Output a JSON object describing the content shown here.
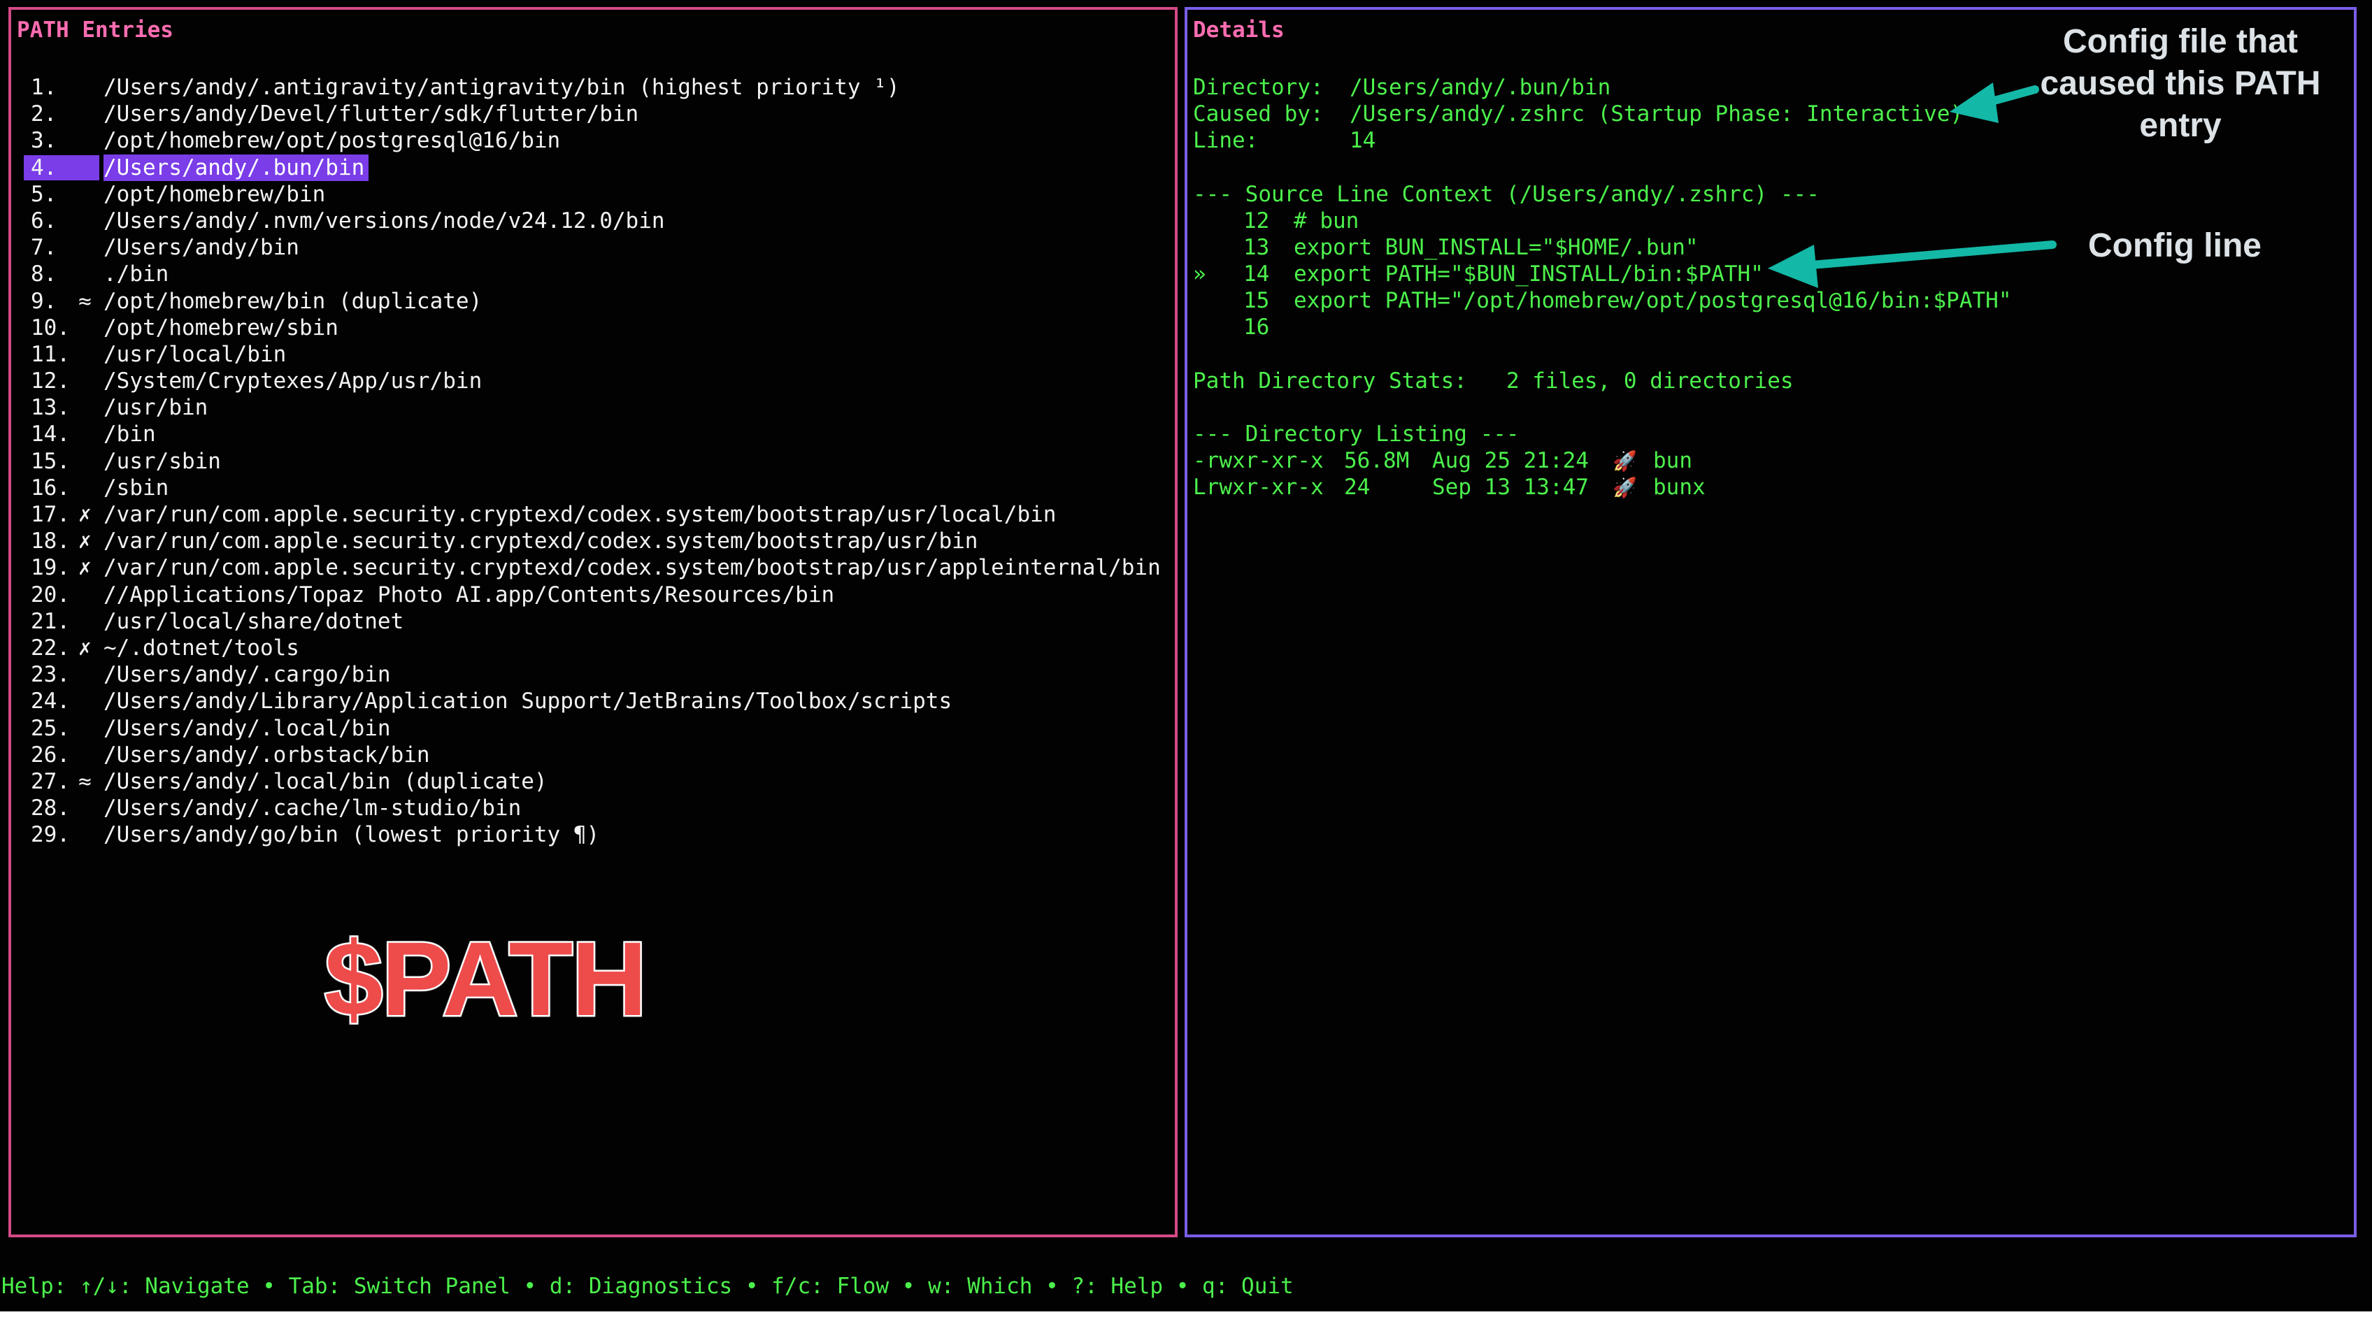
{
  "left_panel": {
    "title": "PATH Entries",
    "entries": [
      {
        "num": "1.",
        "mark": "",
        "path": "/Users/andy/.antigravity/antigravity/bin (highest priority ¹)"
      },
      {
        "num": "2.",
        "mark": "",
        "path": "/Users/andy/Devel/flutter/sdk/flutter/bin"
      },
      {
        "num": "3.",
        "mark": "",
        "path": "/opt/homebrew/opt/postgresql@16/bin"
      },
      {
        "num": "4.",
        "mark": "",
        "path": "/Users/andy/.bun/bin",
        "selected": true
      },
      {
        "num": "5.",
        "mark": "",
        "path": "/opt/homebrew/bin"
      },
      {
        "num": "6.",
        "mark": "",
        "path": "/Users/andy/.nvm/versions/node/v24.12.0/bin"
      },
      {
        "num": "7.",
        "mark": "",
        "path": "/Users/andy/bin"
      },
      {
        "num": "8.",
        "mark": "",
        "path": "./bin"
      },
      {
        "num": "9.",
        "mark": "≈",
        "path": "/opt/homebrew/bin (duplicate)"
      },
      {
        "num": "10.",
        "mark": "",
        "path": "/opt/homebrew/sbin"
      },
      {
        "num": "11.",
        "mark": "",
        "path": "/usr/local/bin"
      },
      {
        "num": "12.",
        "mark": "",
        "path": "/System/Cryptexes/App/usr/bin"
      },
      {
        "num": "13.",
        "mark": "",
        "path": "/usr/bin"
      },
      {
        "num": "14.",
        "mark": "",
        "path": "/bin"
      },
      {
        "num": "15.",
        "mark": "",
        "path": "/usr/sbin"
      },
      {
        "num": "16.",
        "mark": "",
        "path": "/sbin"
      },
      {
        "num": "17.",
        "mark": "✗",
        "path": "/var/run/com.apple.security.cryptexd/codex.system/bootstrap/usr/local/bin"
      },
      {
        "num": "18.",
        "mark": "✗",
        "path": "/var/run/com.apple.security.cryptexd/codex.system/bootstrap/usr/bin"
      },
      {
        "num": "19.",
        "mark": "✗",
        "path": "/var/run/com.apple.security.cryptexd/codex.system/bootstrap/usr/appleinternal/bin"
      },
      {
        "num": "20.",
        "mark": "",
        "path": "//Applications/Topaz Photo AI.app/Contents/Resources/bin"
      },
      {
        "num": "21.",
        "mark": "",
        "path": "/usr/local/share/dotnet"
      },
      {
        "num": "22.",
        "mark": "✗",
        "path": "~/.dotnet/tools"
      },
      {
        "num": "23.",
        "mark": "",
        "path": "/Users/andy/.cargo/bin"
      },
      {
        "num": "24.",
        "mark": "",
        "path": "/Users/andy/Library/Application Support/JetBrains/Toolbox/scripts"
      },
      {
        "num": "25.",
        "mark": "",
        "path": "/Users/andy/.local/bin"
      },
      {
        "num": "26.",
        "mark": "",
        "path": "/Users/andy/.orbstack/bin"
      },
      {
        "num": "27.",
        "mark": "≈",
        "path": "/Users/andy/.local/bin (duplicate)"
      },
      {
        "num": "28.",
        "mark": "",
        "path": "/Users/andy/.cache/lm-studio/bin"
      },
      {
        "num": "29.",
        "mark": "",
        "path": "/Users/andy/go/bin (lowest priority ¶)"
      }
    ],
    "overlay_label": "$PATH"
  },
  "right_panel": {
    "title": "Details",
    "directory_label": "Directory:",
    "directory_value": "/Users/andy/.bun/bin",
    "caused_by_label": "Caused by:",
    "caused_by_value": "/Users/andy/.zshrc (Startup Phase: Interactive)",
    "line_label": "Line:",
    "line_value": "14",
    "context_header": "--- Source Line Context (/Users/andy/.zshrc) ---",
    "context_lines": [
      {
        "marker": "",
        "num": "12",
        "text": "# bun"
      },
      {
        "marker": "",
        "num": "13",
        "text": "export BUN_INSTALL=\"$HOME/.bun\""
      },
      {
        "marker": "»",
        "num": "14",
        "text": "export PATH=\"$BUN_INSTALL/bin:$PATH\""
      },
      {
        "marker": "",
        "num": "15",
        "text": "export PATH=\"/opt/homebrew/opt/postgresql@16/bin:$PATH\""
      },
      {
        "marker": "",
        "num": "16",
        "text": ""
      }
    ],
    "stats_label": "Path Directory Stats:",
    "stats_value": "2 files, 0 directories",
    "listing_header": "--- Directory Listing ---",
    "listing": [
      {
        "perms": "-rwxr-xr-x",
        "size": "56.8M",
        "date": "Aug 25 21:24",
        "icon": "rocket-icon",
        "glyph": "🚀",
        "name": "bun"
      },
      {
        "perms": "Lrwxr-xr-x",
        "size": "24",
        "date": "Sep 13 13:47",
        "icon": "rocket-icon",
        "glyph": "🚀",
        "name": "bunx"
      }
    ]
  },
  "annotations": {
    "config_file": "Config file that caused this PATH entry",
    "config_file_lines": [
      "Config file that",
      "caused this PATH",
      "entry"
    ],
    "config_line": "Config line",
    "arrow_color": "#14b8a6"
  },
  "help_bar": "Help: ↑/↓: Navigate • Tab: Switch Panel • d: Diagnostics • f/c: Flow • w: Which • ?: Help • q: Quit",
  "colors": {
    "left_border": "#d44a86",
    "right_border": "#7a5ee8",
    "title": "#ff6db1",
    "detail_text": "#4cf04c",
    "selection": "#7a3de8",
    "overlay_label": "#ee4b4b"
  }
}
